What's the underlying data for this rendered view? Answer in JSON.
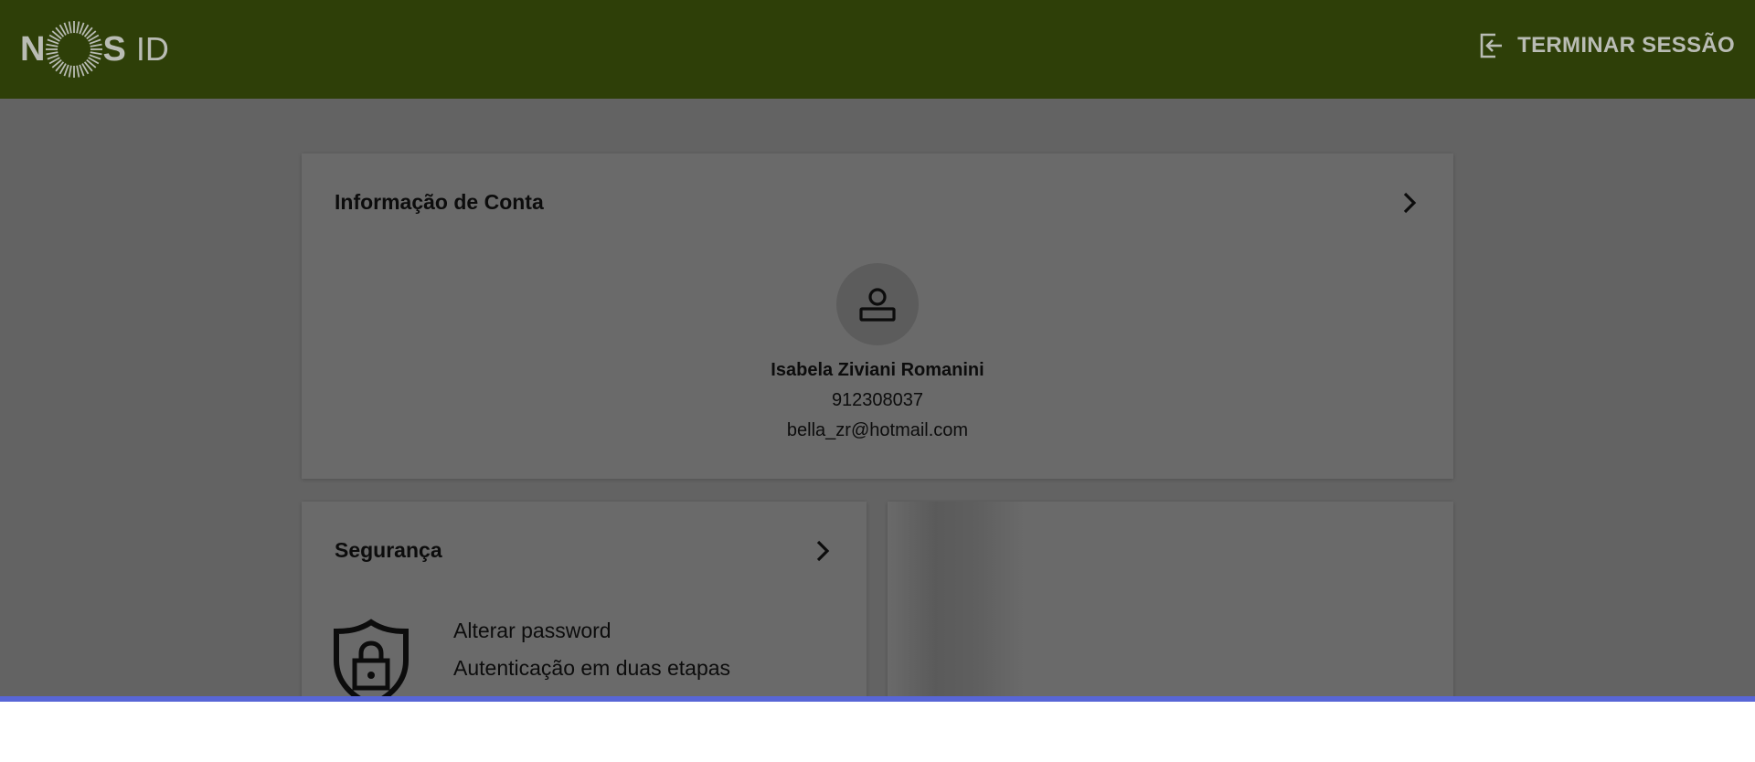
{
  "header": {
    "logo": {
      "letter1": "N",
      "letter2": "S",
      "suffix": "ID"
    },
    "logout_label": "TERMINAR SESSÃO"
  },
  "account_card": {
    "title": "Informação de Conta",
    "name": "Isabela Ziviani Romanini",
    "phone": "912308037",
    "email": "bella_zr@hotmail.com"
  },
  "security_card": {
    "title": "Segurança",
    "links": [
      "Alterar password",
      "Autenticação em duas etapas"
    ]
  },
  "icons": [
    "nos-sun-logo-icon",
    "logout-icon",
    "chevron-right-icon",
    "user-icon",
    "shield-lock-icon"
  ],
  "colors": {
    "header_bg": "#2e3f08",
    "overlay_bg": "#636363",
    "card_bg": "#6a6a6a",
    "accent_bar": "#5866d6"
  }
}
